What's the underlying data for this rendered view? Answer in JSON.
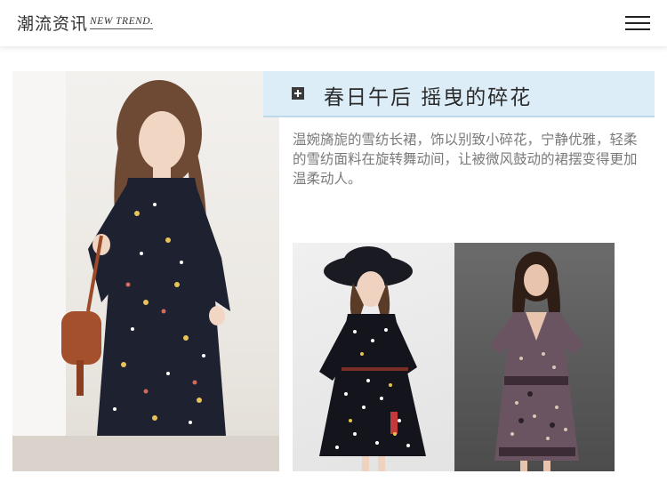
{
  "header": {
    "brand_cn": "潮流资讯",
    "brand_en": "NEW TREND.",
    "menu_icon": "hamburger-menu-icon"
  },
  "article": {
    "title": "春日午后 摇曳的碎花",
    "title_icon": "plus-square-icon",
    "description": "温婉旖旎的雪纺长裙，饰以别致小碎花，宁静优雅，轻柔的雪纺面料在旋转舞动间，让被微风鼓动的裙摆变得更加温柔动人。"
  },
  "images": {
    "main": "model-floral-chiffon-dress-photo",
    "second": "model-polka-dot-dress-hat-photo",
    "third": "model-paisley-print-dress-photo"
  },
  "colors": {
    "title_band": "#dcedf7",
    "title_text": "#2b2b2b",
    "description_text": "#7a7a7a"
  }
}
